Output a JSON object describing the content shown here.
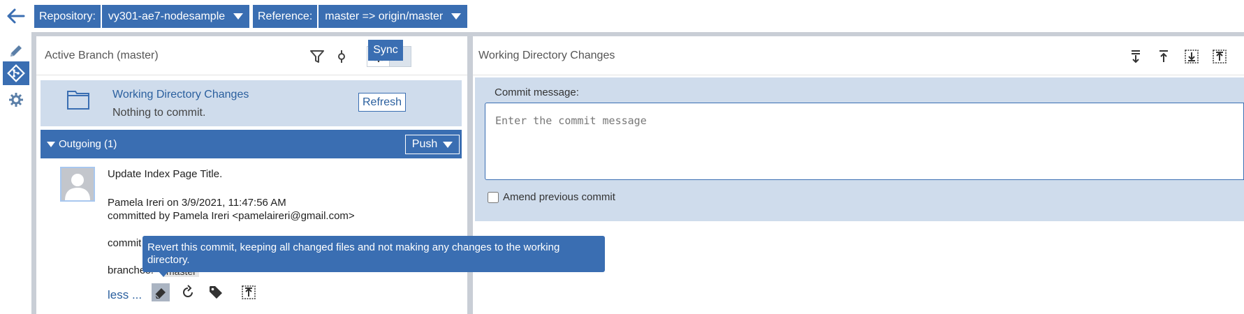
{
  "topbar": {
    "back_icon": "arrow-left-icon",
    "repository_label": "Repository:",
    "repository_value": "vy301-ae7-nodesample",
    "reference_label": "Reference:",
    "reference_value": "master => origin/master"
  },
  "rail": {
    "items": [
      {
        "icon": "pencil-icon"
      },
      {
        "icon": "git-icon",
        "active": true
      },
      {
        "icon": "gear-icon"
      }
    ]
  },
  "left_panel": {
    "title": "Active Branch (master)",
    "sync_label": "Sync",
    "working_dir": {
      "title": "Working Directory Changes",
      "subtitle": "Nothing to commit.",
      "refresh_label": "Refresh"
    },
    "outgoing": {
      "label": "Outgoing (1)",
      "push_label": "Push"
    },
    "commit": {
      "message": "Update Index Page Title.",
      "author_line": "Pamela Ireri on 3/9/2021, 11:47:56 AM",
      "committer_line": "committed by Pamela Ireri <pamelaireri@gmail.com>",
      "commit_label": "commit",
      "branches_label": "branches:",
      "branch_name": "master",
      "less_label": "less ..."
    }
  },
  "right_panel": {
    "title": "Working Directory Changes",
    "commit_message_label": "Commit message:",
    "commit_message_placeholder": "Enter the commit message",
    "amend_label": "Amend previous commit"
  },
  "tooltip": {
    "text": "Revert this commit, keeping all changed files and not making any changes to the working directory."
  },
  "colors": {
    "accent": "#3a6eb2",
    "panel_bg": "#cfdcec",
    "frame": "#c9ced6"
  }
}
